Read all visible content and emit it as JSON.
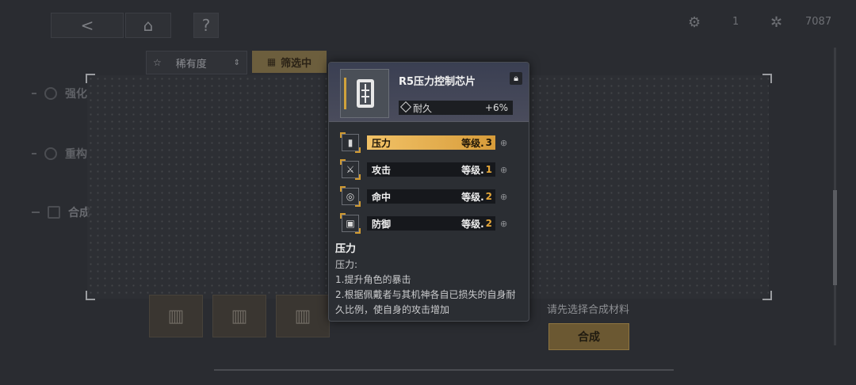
{
  "topbar": {
    "back": "<",
    "help": "?",
    "res1_value": "1",
    "res2_value": "7087"
  },
  "filter": {
    "rarity_label": "稀有度",
    "active_label": "筛选中"
  },
  "nav": {
    "item1": "强化",
    "item2": "重构",
    "item3": "合成"
  },
  "bottom": {
    "hint": "请先选择合成材料",
    "synth_button": "合成"
  },
  "card": {
    "title": "R5压力控制芯片",
    "durability_label": "耐久",
    "durability_value": "+6%",
    "level_label": "等级.",
    "stats": [
      {
        "name": "压力",
        "level": "3",
        "icon": "pressure-icon"
      },
      {
        "name": "攻击",
        "level": "1",
        "icon": "attack-icon"
      },
      {
        "name": "命中",
        "level": "2",
        "icon": "hit-icon"
      },
      {
        "name": "防御",
        "level": "2",
        "icon": "defense-icon"
      }
    ],
    "desc_title": "压力",
    "desc_lines": [
      "压力:",
      "1.提升角色的暴击",
      "2.根据佩戴者与其机神各自已损失的自身耐",
      "久比例，使自身的攻击增加"
    ]
  }
}
